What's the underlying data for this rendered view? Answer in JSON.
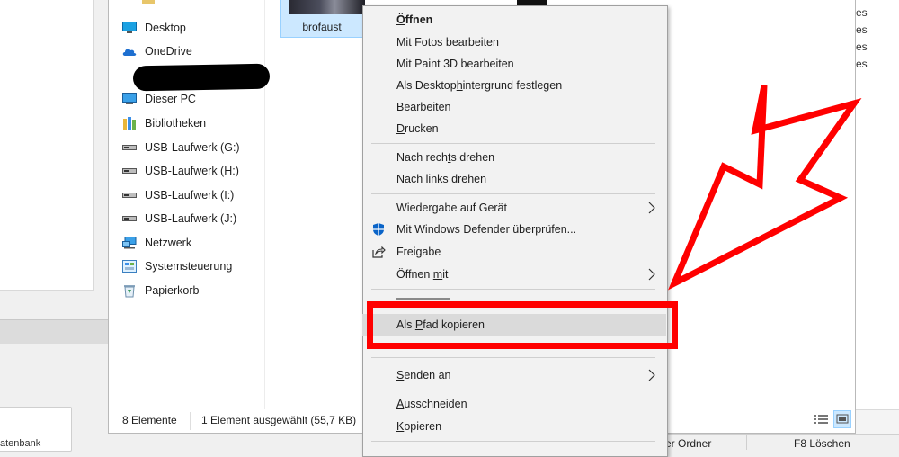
{
  "background": {
    "right_items": [
      "es",
      "es",
      "es",
      "es"
    ],
    "bottom_label": "atenbank",
    "bottom_buttons": [
      "er Ordner",
      "F8 Löschen"
    ]
  },
  "nav": {
    "items": [
      {
        "label": "Desktop",
        "icon": "desktop-icon"
      },
      {
        "label": "OneDrive",
        "icon": "onedrive-icon"
      },
      {
        "label": "Dieser PC",
        "icon": "computer-icon"
      },
      {
        "label": "Bibliotheken",
        "icon": "library-icon"
      },
      {
        "label": "USB-Laufwerk (G:)",
        "icon": "usb-drive-icon"
      },
      {
        "label": "USB-Laufwerk (H:)",
        "icon": "usb-drive-icon"
      },
      {
        "label": "USB-Laufwerk (I:)",
        "icon": "usb-drive-icon"
      },
      {
        "label": "USB-Laufwerk (J:)",
        "icon": "usb-drive-icon"
      },
      {
        "label": "Netzwerk",
        "icon": "network-icon"
      },
      {
        "label": "Systemsteuerung",
        "icon": "control-panel-icon"
      },
      {
        "label": "Papierkorb",
        "icon": "recycle-bin-icon"
      }
    ]
  },
  "thumbnail": {
    "label": "brofaust"
  },
  "status": {
    "count": "8 Elemente",
    "selected": "1 Element ausgewählt (55,7 KB)"
  },
  "context_menu": {
    "items": [
      {
        "pre": "",
        "ul": "Ö",
        "post": "ffnen"
      },
      {
        "pre": "Mit Fotos bearbeiten",
        "ul": "",
        "post": ""
      },
      {
        "pre": "Mit Paint 3D bearbeiten",
        "ul": "",
        "post": ""
      },
      {
        "pre": "Als Desktop",
        "ul": "h",
        "post": "intergrund festlegen"
      },
      {
        "pre": "",
        "ul": "B",
        "post": "earbeiten"
      },
      {
        "pre": "",
        "ul": "D",
        "post": "rucken"
      },
      {
        "pre": "Nach rech",
        "ul": "t",
        "post": "s drehen"
      },
      {
        "pre": "Nach links d",
        "ul": "r",
        "post": "ehen"
      },
      {
        "pre": "Wiedergabe auf Gerät",
        "ul": "",
        "post": ""
      },
      {
        "pre": "Mit Windows Defender überprüfen...",
        "ul": "",
        "post": ""
      },
      {
        "pre": "Freigabe",
        "ul": "",
        "post": ""
      },
      {
        "pre": "Öffnen ",
        "ul": "m",
        "post": "it"
      },
      {
        "pre": "Als ",
        "ul": "P",
        "post": "fad kopieren"
      },
      {
        "pre": "",
        "ul": "S",
        "post": "enden an"
      },
      {
        "pre": "",
        "ul": "A",
        "post": "usschneiden"
      },
      {
        "pre": "",
        "ul": "K",
        "post": "opieren"
      }
    ]
  },
  "colors": {
    "accent": "#0078d7",
    "selection": "#cce8ff",
    "menu_hover": "#dadada",
    "annotation": "#ff0000"
  }
}
